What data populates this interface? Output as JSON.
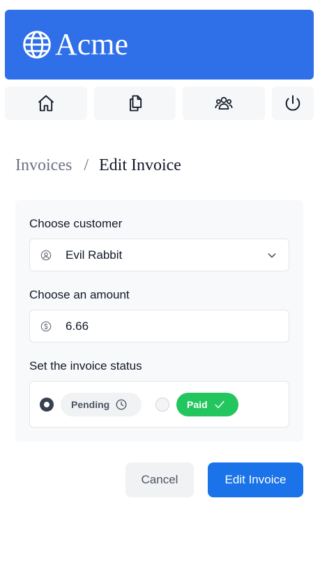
{
  "brand": {
    "name": "Acme",
    "icon": "globe-icon",
    "color": "#2f6fe8"
  },
  "nav": {
    "items": [
      {
        "icon": "home-icon",
        "label": "Home"
      },
      {
        "icon": "documents-icon",
        "label": "Invoices"
      },
      {
        "icon": "users-icon",
        "label": "Customers"
      },
      {
        "icon": "power-icon",
        "label": "Sign Out"
      }
    ]
  },
  "breadcrumb": {
    "parent": "Invoices",
    "separator": "/",
    "current": "Edit Invoice"
  },
  "form": {
    "customer": {
      "label": "Choose customer",
      "value": "Evil Rabbit",
      "icon": "user-circle-icon"
    },
    "amount": {
      "label": "Choose an amount",
      "value": "6.66",
      "icon": "dollar-circle-icon"
    },
    "status": {
      "label": "Set the invoice status",
      "selected": "pending",
      "options": [
        {
          "value": "pending",
          "label": "Pending",
          "icon": "clock-icon",
          "color": "#f1f2f4"
        },
        {
          "value": "paid",
          "label": "Paid",
          "icon": "check-icon",
          "color": "#22c55e"
        }
      ]
    }
  },
  "actions": {
    "cancel_label": "Cancel",
    "submit_label": "Edit Invoice",
    "submit_color": "#1a73e8"
  }
}
